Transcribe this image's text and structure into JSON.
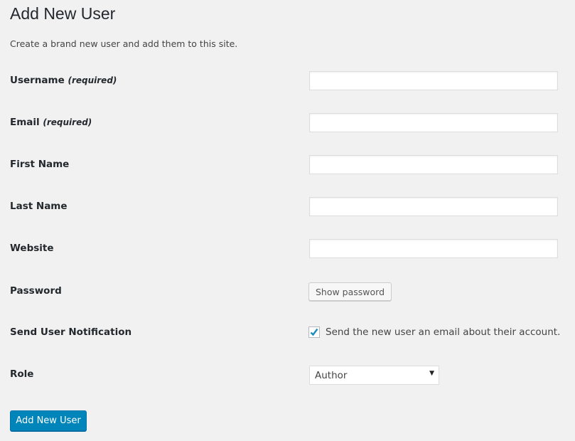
{
  "page": {
    "title": "Add New User",
    "description": "Create a brand new user and add them to this site."
  },
  "fields": {
    "username": {
      "label": "Username",
      "note": "(required)",
      "value": ""
    },
    "email": {
      "label": "Email",
      "note": "(required)",
      "value": ""
    },
    "first_name": {
      "label": "First Name",
      "value": ""
    },
    "last_name": {
      "label": "Last Name",
      "value": ""
    },
    "website": {
      "label": "Website",
      "value": ""
    },
    "password": {
      "label": "Password",
      "button": "Show password"
    },
    "notification": {
      "label": "Send User Notification",
      "checkbox_label": "Send the new user an email about their account.",
      "checked": true
    },
    "role": {
      "label": "Role",
      "selected": "Author"
    }
  },
  "submit_label": "Add New User",
  "colors": {
    "primary": "#0085ba",
    "check": "#1e8cbe",
    "background": "#f1f1f1"
  }
}
